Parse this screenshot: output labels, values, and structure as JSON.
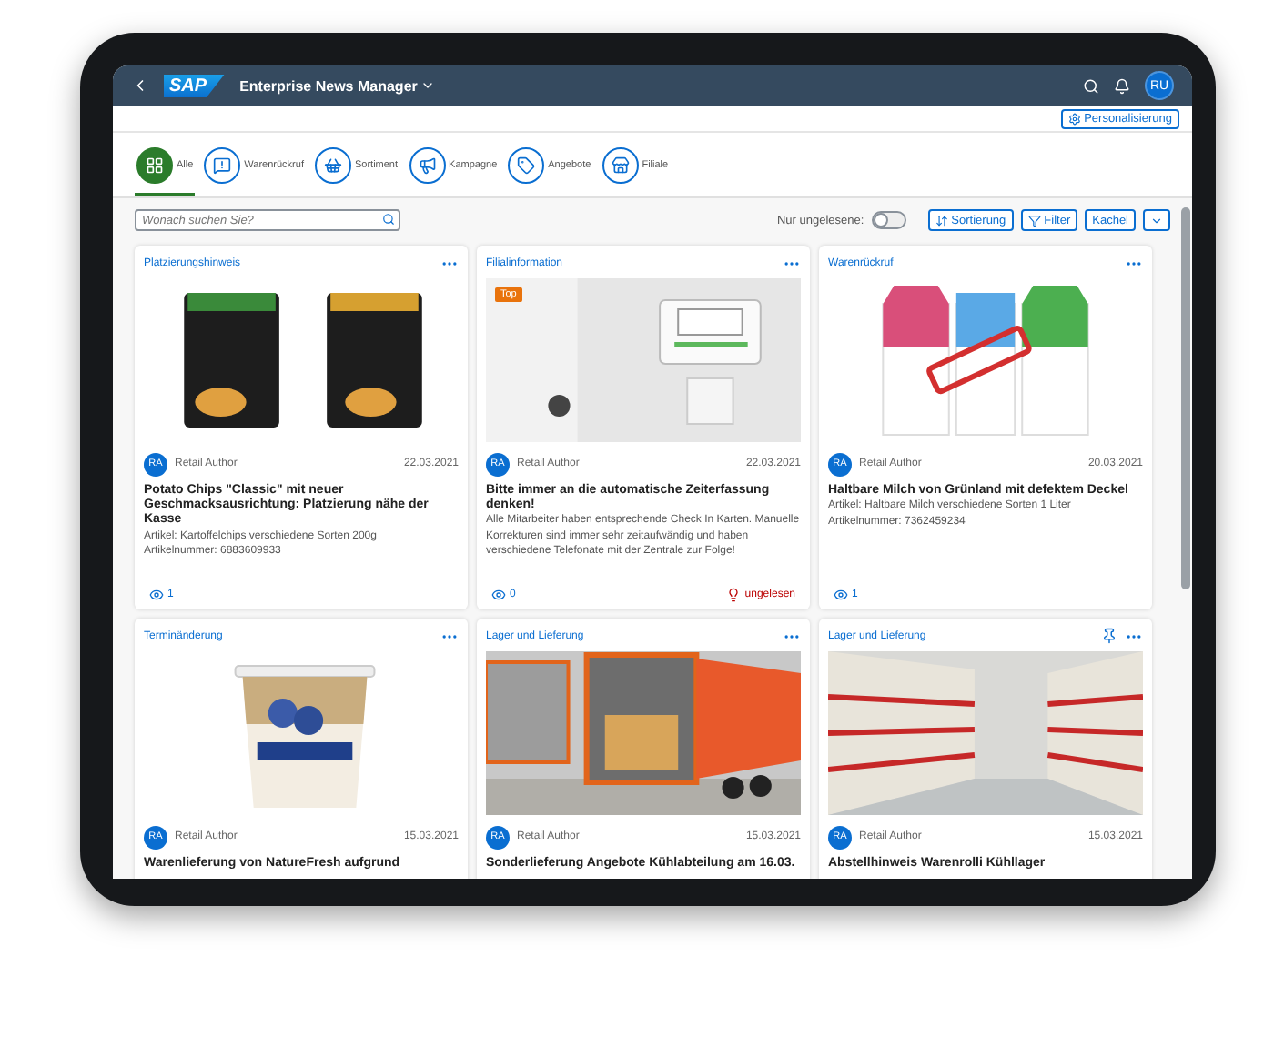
{
  "shell": {
    "logo": "SAP",
    "title": "Enterprise News Manager",
    "avatar": "RU"
  },
  "personalize": "Personalisierung",
  "tabs": [
    {
      "label": "Alle",
      "selected": true
    },
    {
      "label": "Warenrückruf",
      "selected": false
    },
    {
      "label": "Sortiment",
      "selected": false
    },
    {
      "label": "Kampagne",
      "selected": false
    },
    {
      "label": "Angebote",
      "selected": false
    },
    {
      "label": "Filiale",
      "selected": false
    }
  ],
  "toolbar": {
    "search": {
      "placeholder": "Wonach suchen Sie?"
    },
    "toggle": {
      "label": "Nur ungelesene:",
      "on": false
    },
    "sort": "Sortierung",
    "filter": "Filter",
    "view": "Kachel"
  },
  "cards": [
    {
      "category": "Platzierungshinweis",
      "pinned": false,
      "kind": "chips",
      "initials": "RA",
      "author": "Retail Author",
      "date": "22.03.2021",
      "title": "Potato Chips \"Classic\" mit neuer Geschmacksausrichtung: Platzierung nähe der Kasse",
      "lines": [
        "Artikel: Kartoffelchips verschiedene Sorten 200g",
        "Artikelnummer: 6883609933"
      ],
      "views": "1"
    },
    {
      "category": "Filialinformation",
      "pinned": false,
      "badge": "Top",
      "kind": "terminal",
      "initials": "RA",
      "author": "Retail Author",
      "date": "22.03.2021",
      "title": "Bitte immer an die automatische Zeiterfassung denken!",
      "lines": [
        "Alle Mitarbeiter haben entsprechende Check In Karten. Manuelle Korrekturen sind immer sehr zeitaufwändig und haben verschiedene Telefonate mit der Zentrale zur Folge!"
      ],
      "views": "0",
      "unread": "ungelesen"
    },
    {
      "category": "Warenrückruf",
      "pinned": false,
      "kind": "milk",
      "initials": "RA",
      "author": "Retail Author",
      "date": "20.03.2021",
      "title": "Haltbare Milch von Grünland mit defektem Deckel",
      "lines": [
        "Artikel: Haltbare Milch verschiedene Sorten 1 Liter",
        "Artikelnummer: 7362459234"
      ],
      "views": "1"
    },
    {
      "category": "Terminänderung",
      "pinned": false,
      "kind": "yogurt",
      "initials": "RA",
      "author": "Retail Author",
      "date": "15.03.2021",
      "title": "Warenlieferung von NatureFresh aufgrund"
    },
    {
      "category": "Lager und Lieferung",
      "pinned": false,
      "kind": "truck",
      "initials": "RA",
      "author": "Retail Author",
      "date": "15.03.2021",
      "title": "Sonderlieferung Angebote Kühlabteilung am 16.03."
    },
    {
      "category": "Lager und Lieferung",
      "pinned": true,
      "kind": "warehouse",
      "initials": "RA",
      "author": "Retail Author",
      "date": "15.03.2021",
      "title": "Abstellhinweis Warenrolli Kühllager"
    }
  ]
}
